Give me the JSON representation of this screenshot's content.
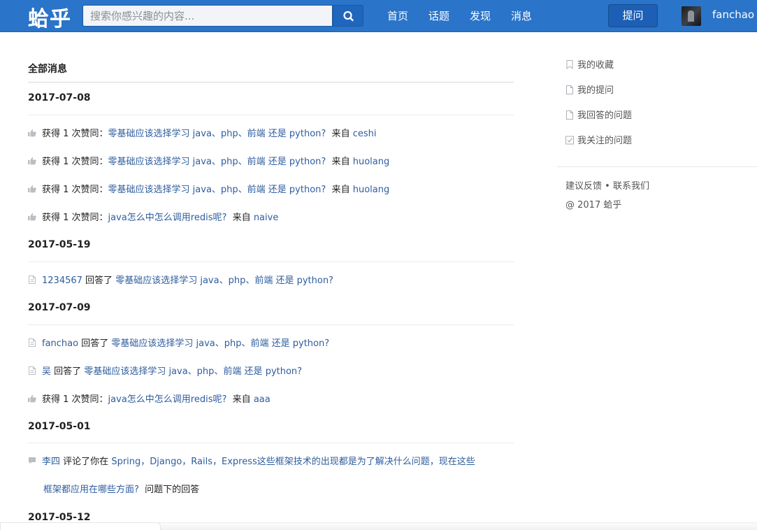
{
  "nav": {
    "logo": "蛤乎",
    "search_placeholder": "搜索你感兴趣的内容...",
    "links": [
      "首页",
      "话题",
      "发现",
      "消息"
    ],
    "ask_label": "提问",
    "username": "fanchao"
  },
  "main": {
    "title": "全部消息",
    "groups": [
      {
        "date": "2017-07-08",
        "items": [
          {
            "type": "like",
            "prefix": "获得 1 次赞同：",
            "link": "零基础应该选择学习 java、php、前端 还是 python?",
            "from": "来自",
            "user": "ceshi"
          },
          {
            "type": "like",
            "prefix": "获得 1 次赞同：",
            "link": "零基础应该选择学习 java、php、前端 还是 python?",
            "from": "来自",
            "user": "huolang"
          },
          {
            "type": "like",
            "prefix": "获得 1 次赞同：",
            "link": "零基础应该选择学习 java、php、前端 还是 python?",
            "from": "来自",
            "user": "huolang"
          },
          {
            "type": "like",
            "prefix": "获得 1 次赞同：",
            "link": "java怎么中怎么调用redis呢?",
            "from": "来自",
            "user": "naive"
          }
        ]
      },
      {
        "date": "2017-05-19",
        "items": [
          {
            "type": "answer",
            "user": "1234567",
            "verb": "回答了",
            "link": "零基础应该选择学习 java、php、前端 还是 python?"
          }
        ]
      },
      {
        "date": "2017-07-09",
        "items": [
          {
            "type": "answer",
            "user": "fanchao",
            "verb": "回答了",
            "link": "零基础应该选择学习 java、php、前端 还是 python?"
          },
          {
            "type": "answer",
            "user": "吴",
            "verb": "回答了",
            "link": "零基础应该选择学习 java、php、前端 还是 python?"
          },
          {
            "type": "like",
            "prefix": "获得 1 次赞同：",
            "link": "java怎么中怎么调用redis呢?",
            "from": "来自",
            "user": "aaa"
          }
        ]
      },
      {
        "date": "2017-05-01",
        "items": [
          {
            "type": "comment",
            "user": "李四",
            "verb": "评论了你在",
            "link_line1": "Spring，Django，Rails，Express这些框架技术的出现都是为了解决什么问题，现在这些",
            "link_line2": "框架都应用在哪些方面?",
            "suffix": "问题下的回答"
          }
        ]
      },
      {
        "date": "2017-05-12",
        "items": []
      }
    ]
  },
  "sidebar": {
    "items": [
      {
        "label": "我的收藏",
        "icon": "bookmark-icon"
      },
      {
        "label": "我的提问",
        "icon": "document-icon"
      },
      {
        "label": "我回答的问题",
        "icon": "document-icon"
      },
      {
        "label": "我关注的问题",
        "icon": "checkbox-icon"
      }
    ],
    "footer_links": [
      "建议反馈",
      "联系我们"
    ],
    "footer_sep": "•",
    "copyright": "@ 2017 蛤乎"
  },
  "colors": {
    "brand": "#2a74c9",
    "link": "#2e5d9e"
  }
}
